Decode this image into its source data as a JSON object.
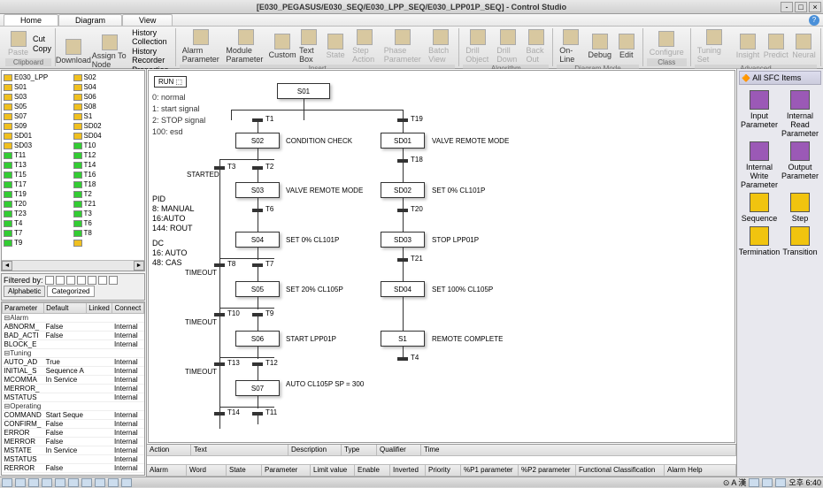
{
  "title": "[E030_PEGASUS/E030_SEQ/E030_LPP_SEQ/E030_LPP01P_SEQ] - Control Studio",
  "tabs": {
    "home": "Home",
    "diagram": "Diagram",
    "view": "View"
  },
  "ribbon": {
    "clipboard": {
      "label": "Clipboard",
      "paste": "Paste",
      "cut": "Cut",
      "copy": "Copy"
    },
    "module": {
      "label": "Module",
      "download": "Download",
      "assign": "Assign To Node",
      "hist": "History Collection",
      "rec": "History Recorder",
      "prop": "Properties"
    },
    "insert": {
      "label": "Insert",
      "alarm": "Alarm Parameter",
      "modparam": "Module Parameter",
      "custom": "Custom",
      "textbox": "Text Box",
      "state": "State",
      "step": "Step Action",
      "phase": "Phase Parameter",
      "batch": "Batch View"
    },
    "algo": {
      "label": "Algorithm",
      "drillobj": "Drill Object",
      "drilldown": "Drill Down",
      "backout": "Back Out"
    },
    "diagmode": {
      "label": "Diagram Mode",
      "online": "On-Line",
      "debug": "Debug",
      "edit": "Edit"
    },
    "class": {
      "label": "Class",
      "configure": "Configure"
    },
    "adv": {
      "label": "Advanced",
      "tuning": "Tuning Set",
      "insight": "Insight",
      "predict": "Predict",
      "neural": "Neural"
    }
  },
  "tree_root": "E030_LPP",
  "tree_items_left": [
    "S01",
    "S03",
    "S05",
    "S07",
    "S09",
    "SD01",
    "SD03",
    "T11",
    "T13",
    "T15",
    "T17",
    "T19",
    "T20",
    "T23",
    "T4",
    "T7",
    "T9"
  ],
  "tree_items_right": [
    "S02",
    "S04",
    "S06",
    "S08",
    "S1",
    "SD02",
    "SD04",
    "T10",
    "T12",
    "T14",
    "T16",
    "T18",
    "T2",
    "T21",
    "T3",
    "T6",
    "T8",
    ""
  ],
  "filter": {
    "label": "Filtered by:",
    "alphabetic": "Alphabetic",
    "categorized": "Categorized"
  },
  "params": {
    "headers": [
      "Parameter",
      "Default",
      "Linked",
      "Connect"
    ],
    "rows": [
      [
        "⊟Alarm",
        "",
        "",
        ""
      ],
      [
        "  ABNORM_",
        "False",
        "",
        "Internal"
      ],
      [
        "  BAD_ACTI",
        "False",
        "",
        "Internal"
      ],
      [
        "  BLOCK_E",
        "",
        "",
        "Internal"
      ],
      [
        "⊟Tuning",
        "",
        "",
        ""
      ],
      [
        "  AUTO_AD",
        "True",
        "",
        "Internal"
      ],
      [
        "  INITIAL_S",
        "Sequence A",
        "",
        "Internal"
      ],
      [
        "  MCOMMA",
        "In Service",
        "",
        "Internal"
      ],
      [
        "  MERROR_",
        "",
        "",
        "Internal"
      ],
      [
        "  MSTATUS",
        "",
        "",
        "Internal"
      ],
      [
        "⊟Operating",
        "",
        "",
        ""
      ],
      [
        "  COMMAND",
        "Start Seque",
        "",
        "Internal"
      ],
      [
        "  CONFIRM_",
        "False",
        "",
        "Internal"
      ],
      [
        "  ERROR",
        "False",
        "",
        "Internal"
      ],
      [
        "  MERROR",
        "False",
        "",
        "Internal"
      ],
      [
        "  MSTATE",
        "In Service",
        "",
        "Internal"
      ],
      [
        "  MSTATUS",
        "",
        "",
        "Internal"
      ],
      [
        "  RERROR",
        "False",
        "",
        "Internal"
      ]
    ]
  },
  "canvas": {
    "run": "RUN ⬚",
    "sig": [
      "0: normal",
      "1: start signal",
      "2: STOP signal",
      "100: esd"
    ],
    "pid": [
      "PID",
      "8: MANUAL",
      "16:AUTO",
      "144: ROUT"
    ],
    "dc": [
      "DC",
      "16: AUTO",
      "48: CAS"
    ],
    "nodes": {
      "S01": "S01",
      "S02": "S02",
      "S03": "S03",
      "S04": "S04",
      "S05": "S05",
      "S06": "S06",
      "S07": "S07",
      "SD01": "SD01",
      "SD02": "SD02",
      "SD03": "SD03",
      "SD04": "SD04",
      "S1": "S1"
    },
    "desc": {
      "S02": "CONDITION CHECK",
      "S03": "VALVE REMOTE MODE",
      "S04": "SET 0% CL101P",
      "S05": "SET 20% CL105P",
      "S06": "START LPP01P",
      "S07": "AUTO CL105P SP = 300",
      "SD01": "VALVE REMOTE MODE",
      "SD02": "SET 0% CL101P",
      "SD03": "STOP LPP01P",
      "SD04": "SET 100% CL105P",
      "S1": "REMOTE COMPLETE"
    },
    "t": {
      "T1": "T1",
      "T2": "T2",
      "T3": "T3",
      "T4": "T4",
      "T6": "T6",
      "T8": "T8",
      "T9": "T9",
      "T10": "T10",
      "T11": "T11",
      "T12": "T12",
      "T13": "T13",
      "T14": "T14",
      "T18": "T18",
      "T19": "T19",
      "T20": "T20",
      "T21": "T21"
    },
    "timeout": "TIMEOUT",
    "started": "STARTED"
  },
  "bottom1": {
    "action": "Action",
    "text": "Text",
    "description": "Description",
    "type": "Type",
    "qualifier": "Qualifier",
    "time": "Time"
  },
  "bottom2": {
    "alarm": "Alarm",
    "word": "Word",
    "state": "State",
    "parameter": "Parameter",
    "limit": "Limit value",
    "enable": "Enable",
    "inverted": "Inverted",
    "priority": "Priority",
    "p1": "%P1 parameter",
    "p2": "%P2 parameter",
    "class": "Functional Classification",
    "help": "Alarm Help"
  },
  "palette": {
    "title": "All SFC Items",
    "items": [
      {
        "label": "Input Parameter",
        "c": "p"
      },
      {
        "label": "Internal Read Parameter",
        "c": "p"
      },
      {
        "label": "Internal Write Parameter",
        "c": "p"
      },
      {
        "label": "Output Parameter",
        "c": "p"
      },
      {
        "label": "Sequence",
        "c": "y"
      },
      {
        "label": "Step",
        "c": "y"
      },
      {
        "label": "Termination",
        "c": "y"
      },
      {
        "label": "Transition",
        "c": "y"
      }
    ]
  },
  "clock": "오후 6:40"
}
